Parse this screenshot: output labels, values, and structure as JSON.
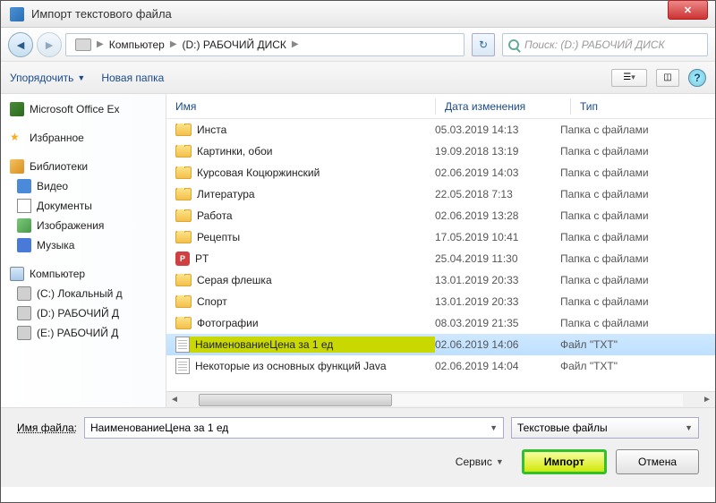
{
  "title": "Импорт текстового файла",
  "breadcrumb": {
    "seg1": "Компьютер",
    "seg2": "(D:) РАБОЧИЙ ДИСК"
  },
  "search": {
    "placeholder": "Поиск: (D:) РАБОЧИЙ ДИСК"
  },
  "toolbar": {
    "organize": "Упорядочить",
    "newfolder": "Новая папка"
  },
  "columns": {
    "name": "Имя",
    "date": "Дата изменения",
    "type": "Тип"
  },
  "nav": {
    "excel": "Microsoft Office Ex",
    "favorites": "Избранное",
    "libraries": "Библиотеки",
    "video": "Видео",
    "documents": "Документы",
    "pictures": "Изображения",
    "music": "Музыка",
    "computer": "Компьютер",
    "drive_c": "(C:) Локальный д",
    "drive_d": "(D:) РАБОЧИЙ Д",
    "drive_e": "(E:) РАБОЧИЙ Д"
  },
  "rows": [
    {
      "name": "Инста",
      "date": "05.03.2019 14:13",
      "type": "Папка с файлами",
      "kind": "folder"
    },
    {
      "name": "Картинки, обои",
      "date": "19.09.2018 13:19",
      "type": "Папка с файлами",
      "kind": "folder"
    },
    {
      "name": "Курсовая Коцюржинский",
      "date": "02.06.2019 14:03",
      "type": "Папка с файлами",
      "kind": "folder"
    },
    {
      "name": "Литература",
      "date": "22.05.2018 7:13",
      "type": "Папка с файлами",
      "kind": "folder"
    },
    {
      "name": "Работа",
      "date": "02.06.2019 13:28",
      "type": "Папка с файлами",
      "kind": "folder"
    },
    {
      "name": "Рецепты",
      "date": "17.05.2019 10:41",
      "type": "Папка с файлами",
      "kind": "folder"
    },
    {
      "name": "PT",
      "date": "25.04.2019 11:30",
      "type": "Папка с файлами",
      "kind": "pt"
    },
    {
      "name": "Серая флешка",
      "date": "13.01.2019 20:33",
      "type": "Папка с файлами",
      "kind": "folder"
    },
    {
      "name": "Спорт",
      "date": "13.01.2019 20:33",
      "type": "Папка с файлами",
      "kind": "folder"
    },
    {
      "name": "Фотографии",
      "date": "08.03.2019 21:35",
      "type": "Папка с файлами",
      "kind": "folder"
    },
    {
      "name": "НаименованиеЦена за 1 ед",
      "date": "02.06.2019 14:06",
      "type": "Файл \"TXT\"",
      "kind": "txt",
      "selected": true
    },
    {
      "name": "Некоторые из основных функций Java",
      "date": "02.06.2019 14:04",
      "type": "Файл \"TXT\"",
      "kind": "txt"
    }
  ],
  "bottom": {
    "filename_label": "Имя файла:",
    "filename_value": "НаименованиеЦена за 1 ед",
    "filter": "Текстовые файлы",
    "service": "Сервис",
    "import": "Импорт",
    "cancel": "Отмена"
  }
}
